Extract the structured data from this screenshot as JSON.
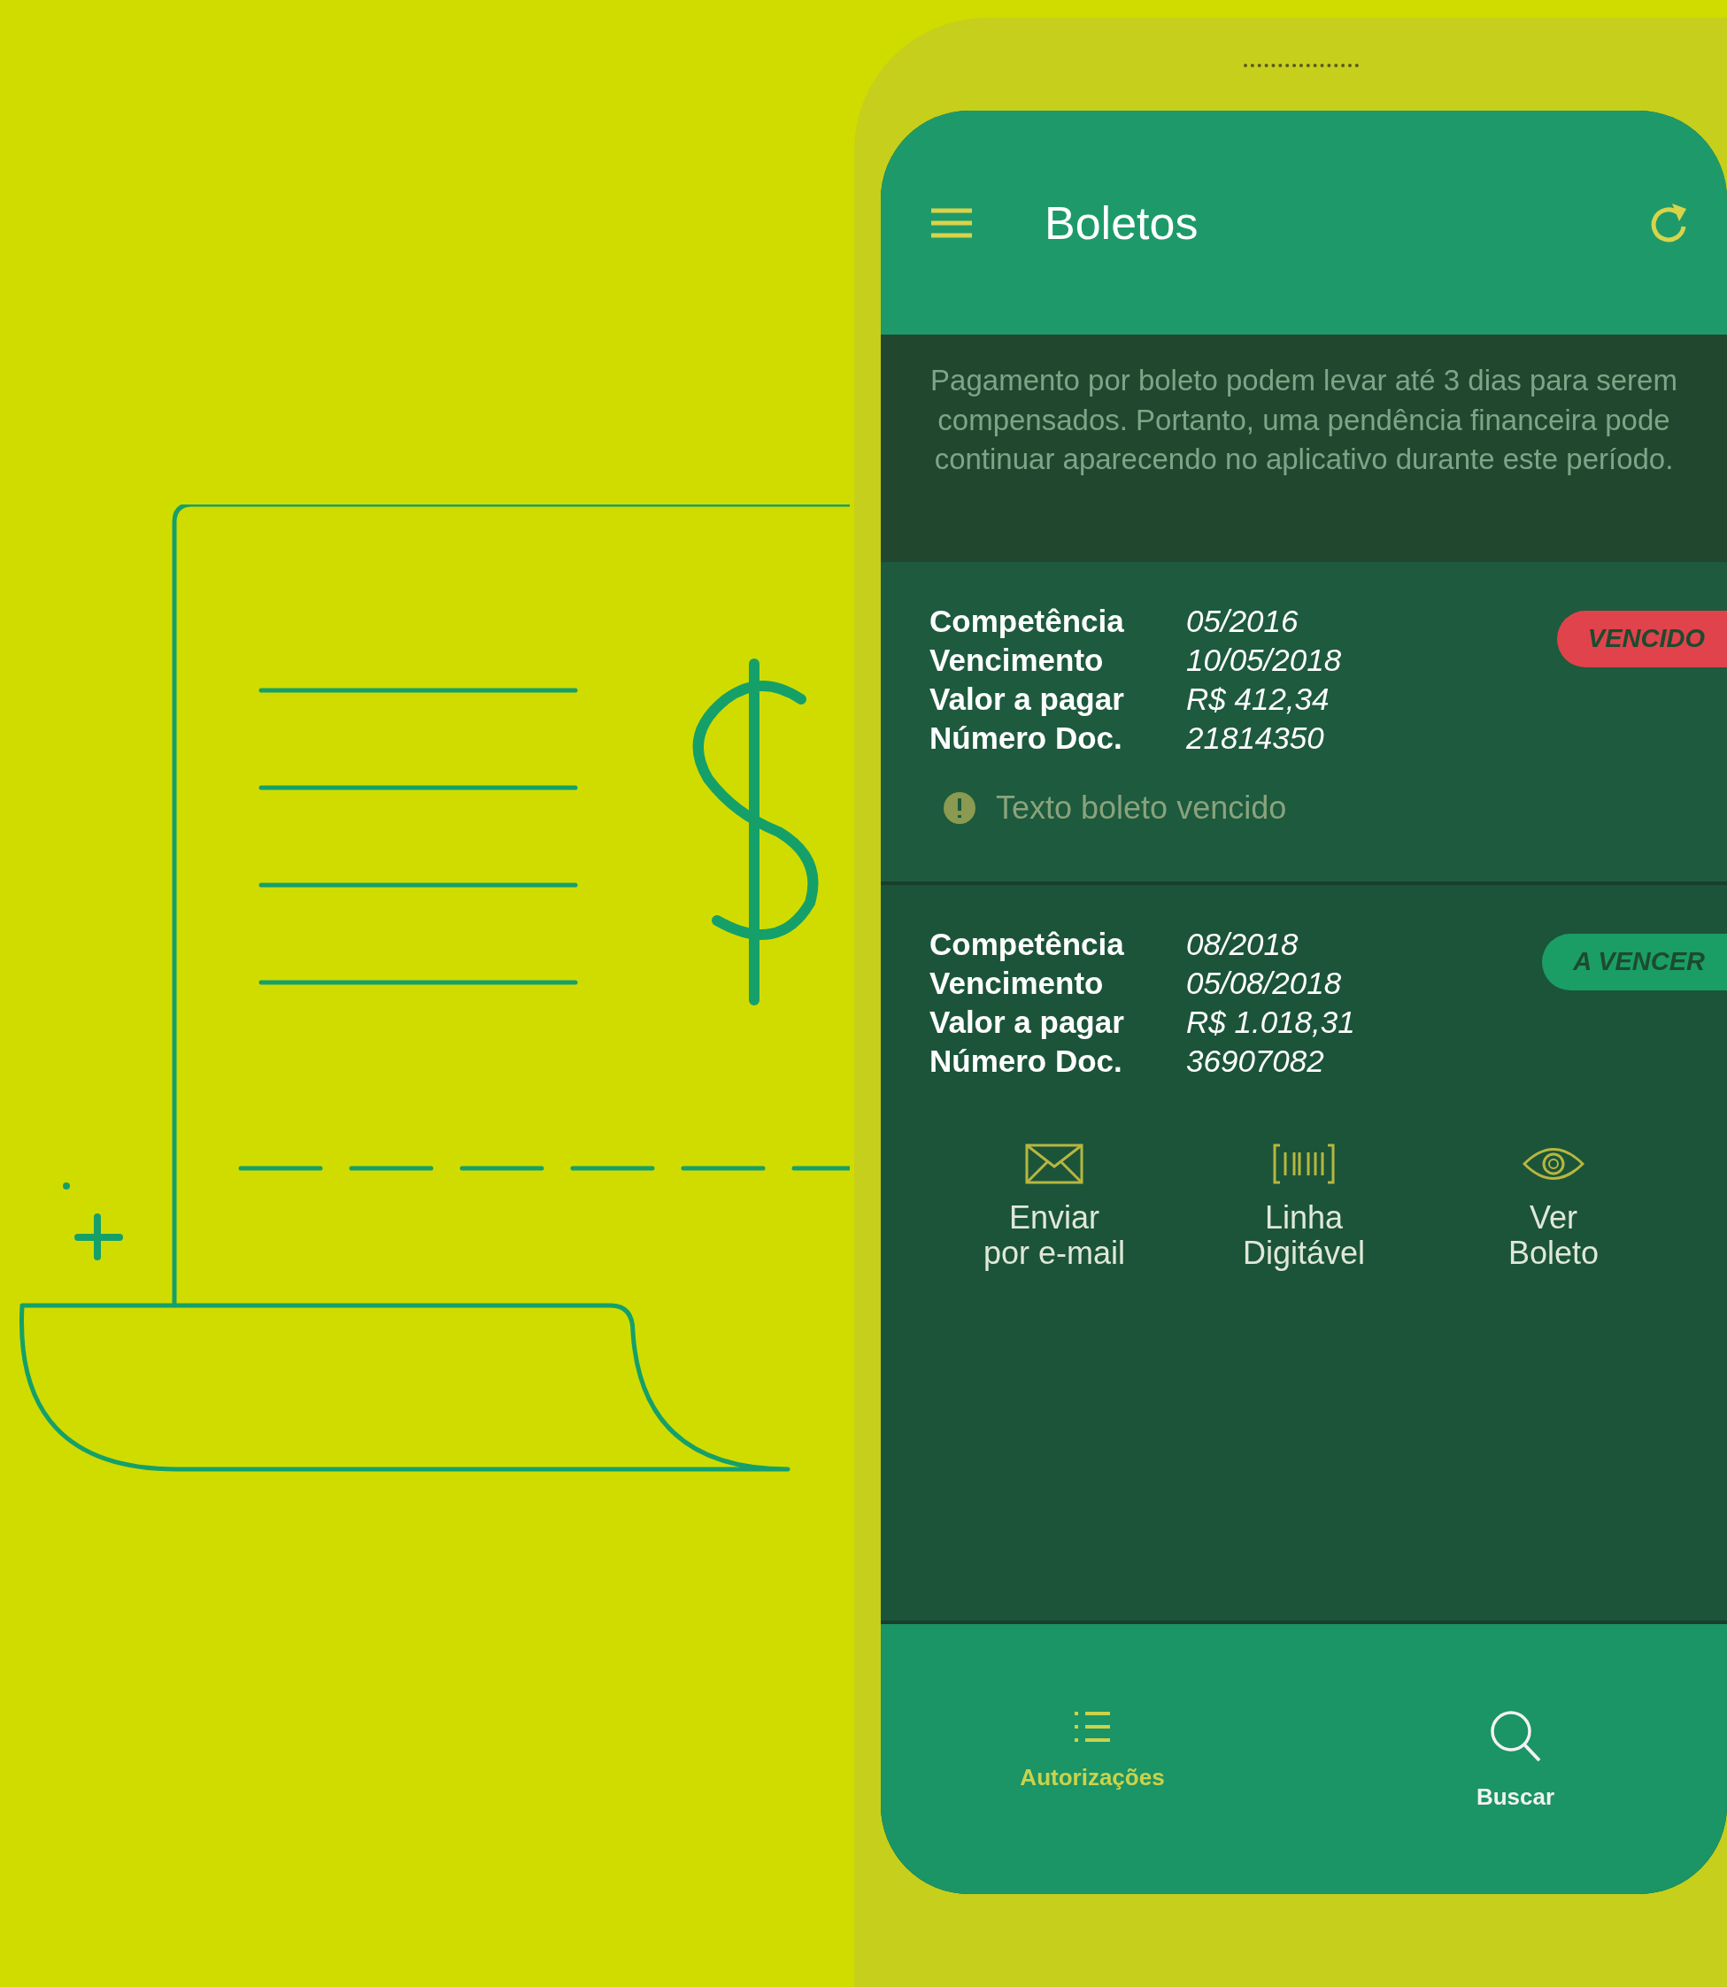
{
  "app_bar": {
    "title": "Boletos"
  },
  "notice": "Pagamento por boleto podem levar até 3 dias para serem compensados. Portanto, uma pendência financeira pode continuar aparecendo no aplicativo durante este período.",
  "boletos": [
    {
      "fields": [
        {
          "label": "Competência",
          "value": "05/2016"
        },
        {
          "label": "Vencimento",
          "value": "10/05/2018"
        },
        {
          "label": "Valor a pagar",
          "value": "R$ 412,34"
        },
        {
          "label": "Número Doc.",
          "value": "21814350"
        }
      ],
      "status": {
        "label": "VENCIDO",
        "color": "#e0434b"
      },
      "note": "Texto boleto vencido"
    },
    {
      "fields": [
        {
          "label": "Competência",
          "value": "08/2018"
        },
        {
          "label": "Vencimento",
          "value": "05/08/2018"
        },
        {
          "label": "Valor a pagar",
          "value": "R$ 1.018,31"
        },
        {
          "label": "Número Doc.",
          "value": "36907082"
        }
      ],
      "status": {
        "label": "A VENCER",
        "color": "#1a9e66"
      },
      "actions": [
        {
          "kind": "email",
          "label": "Enviar\npor e-mail"
        },
        {
          "kind": "barcode",
          "label": "Linha\nDigitável"
        },
        {
          "kind": "view",
          "label": "Ver\nBoleto"
        }
      ]
    }
  ],
  "bottom_nav": [
    {
      "kind": "list",
      "label": "Autorizações",
      "selected": true
    },
    {
      "kind": "search",
      "label": "Buscar",
      "selected": false
    }
  ]
}
